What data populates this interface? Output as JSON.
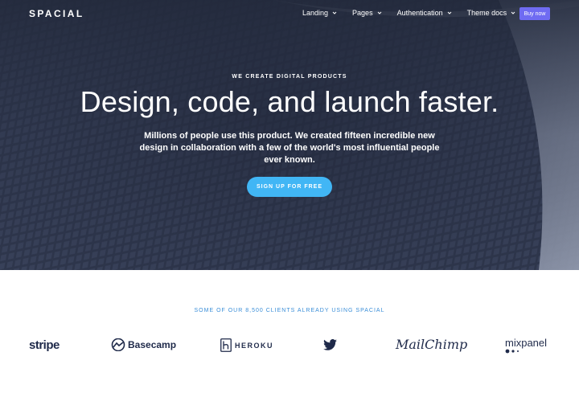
{
  "brand": {
    "name": "SPACIAL"
  },
  "nav": {
    "items": [
      {
        "label": "Landing"
      },
      {
        "label": "Pages"
      },
      {
        "label": "Authentication"
      },
      {
        "label": "Theme docs"
      }
    ],
    "buy_label": "Buy now"
  },
  "hero": {
    "eyebrow": "WE CREATE DIGITAL PRODUCTS",
    "headline": "Design, code, and launch faster.",
    "subtext": "Millions of people use this product. We created fifteen incredible new design in collaboration with a few of the world's most influential people ever known.",
    "cta_label": "SIGN UP FOR FREE"
  },
  "clients": {
    "title": "SOME OF OUR 8,500 CLIENTS ALREADY USING SPACIAL",
    "logos": {
      "stripe": "stripe",
      "basecamp": "Basecamp",
      "heroku": "HEROKU",
      "twitter": "twitter-bird-icon",
      "mailchimp": "MailChimp",
      "mixpanel": "mixpanel"
    }
  },
  "colors": {
    "accent": "#6f6bf2",
    "cta": "#41b6f5",
    "clients_title": "#3a8ed8",
    "logo_dark": "#1f2a4a",
    "hero_bg": "#2d344a"
  }
}
